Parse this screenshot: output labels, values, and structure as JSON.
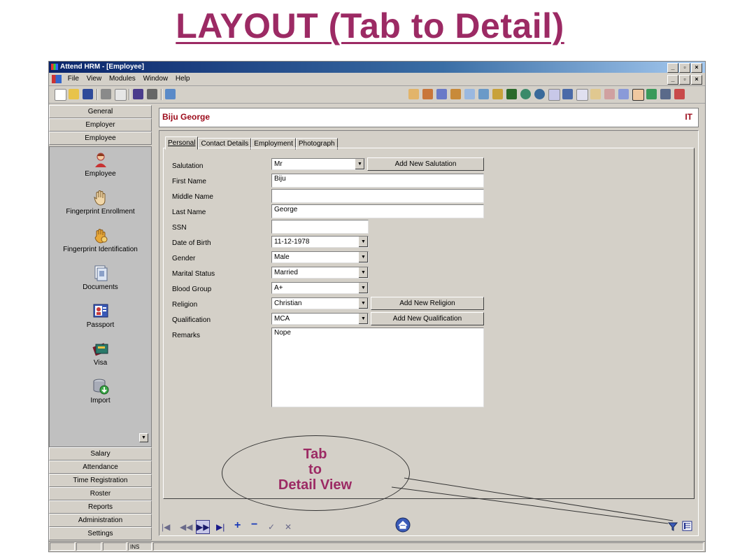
{
  "slide_title": "LAYOUT (Tab to Detail)",
  "window": {
    "title": "Attend HRM - [Employee]",
    "controls": [
      "_",
      "©",
      "x"
    ]
  },
  "menu": [
    "File",
    "View",
    "Modules",
    "Window",
    "Help"
  ],
  "sidebar": {
    "top_headers": [
      "General",
      "Employer",
      "Employee"
    ],
    "items": [
      {
        "label": "Employee",
        "icon": "person-icon"
      },
      {
        "label": "Fingerprint Enrollment",
        "icon": "hand-icon"
      },
      {
        "label": "Fingerprint Identification",
        "icon": "fingerprint-icon"
      },
      {
        "label": "Documents",
        "icon": "documents-icon"
      },
      {
        "label": "Passport",
        "icon": "passport-icon"
      },
      {
        "label": "Visa",
        "icon": "visa-card-icon"
      },
      {
        "label": "Import",
        "icon": "database-import-icon"
      }
    ],
    "bottom_headers": [
      "Salary",
      "Attendance",
      "Time Registration",
      "Roster",
      "Reports",
      "Administration",
      "Settings"
    ]
  },
  "employee": {
    "name": "Biju George",
    "department": "IT"
  },
  "tabs": [
    "Personal",
    "Contact Details",
    "Employment",
    "Photograph"
  ],
  "form": {
    "labels": {
      "salutation": "Salutation",
      "first_name": "First Name",
      "middle_name": "Middle Name",
      "last_name": "Last Name",
      "ssn": "SSN",
      "dob": "Date of Birth",
      "gender": "Gender",
      "marital": "Marital Status",
      "blood": "Blood Group",
      "religion": "Religion",
      "qualification": "Qualification",
      "remarks": "Remarks"
    },
    "values": {
      "salutation": "Mr",
      "first_name": "Biju",
      "middle_name": "",
      "last_name": "George",
      "ssn": "",
      "dob": "11-12-1978",
      "gender": "Male",
      "marital": "Married",
      "blood": "A+",
      "religion": "Christian",
      "qualification": "MCA",
      "remarks": "Nope"
    },
    "buttons": {
      "add_salutation": "Add New Salutation",
      "add_religion": "Add New Religion",
      "add_qualification": "Add New Qualification"
    }
  },
  "statusbar": {
    "ins": "INS"
  },
  "callout": {
    "line1": "Tab",
    "line2": "to",
    "line3": "Detail View"
  },
  "colors": {
    "title": "#9c2a64",
    "employee_name": "#9c0a1a"
  }
}
